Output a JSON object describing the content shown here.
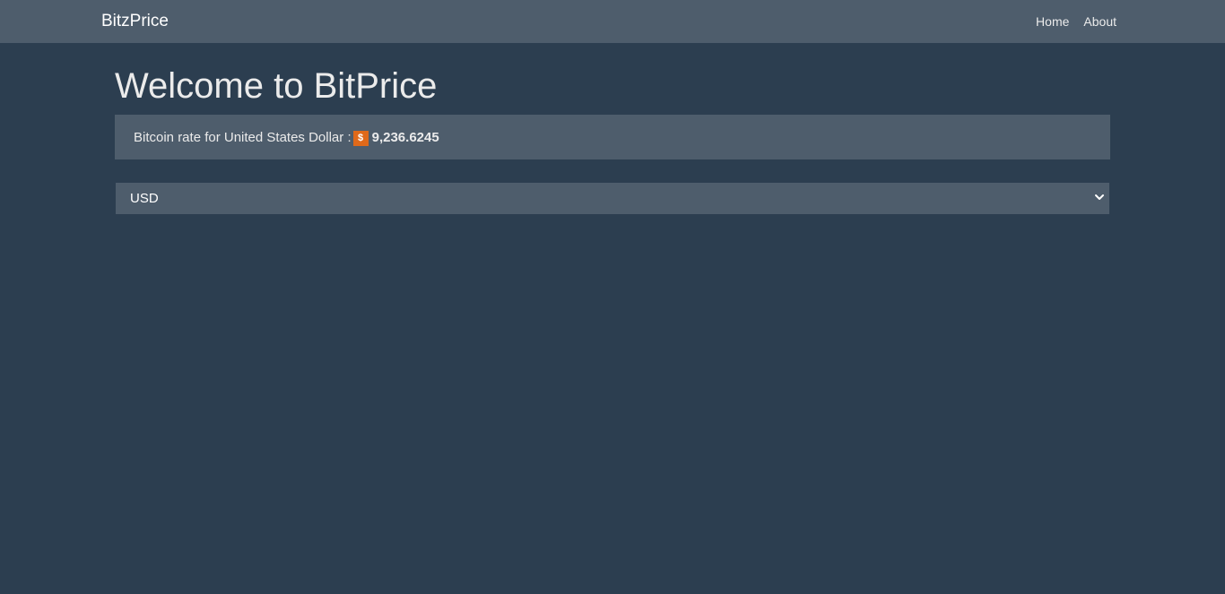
{
  "navbar": {
    "brand": "BitzPrice",
    "links": [
      "Home",
      "About"
    ]
  },
  "main": {
    "title": "Welcome to BitPrice",
    "rate_label": "Bitcoin rate for United States Dollar :",
    "currency_symbol": "$",
    "rate_value": "9,236.6245",
    "currency_select": {
      "selected": "USD"
    }
  },
  "colors": {
    "background": "#2c3e50",
    "navbar": "#4e5d6c",
    "accent": "#df691a"
  },
  "icons": {
    "badge": "dollar-icon",
    "select_arrow": "chevron-down-icon"
  }
}
